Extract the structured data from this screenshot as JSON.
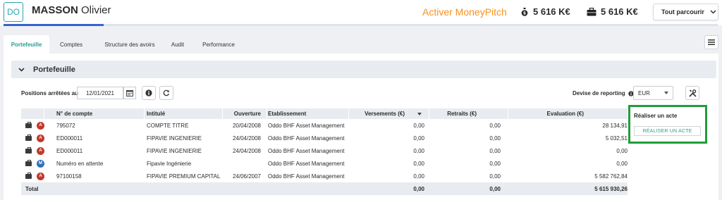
{
  "header": {
    "avatar_initials": "DO",
    "client_last_name": "MASSON",
    "client_first_name": "Olivier",
    "progress": 0.14,
    "activate_label": "Activer MoneyPitch",
    "amount_1": "5 616 K€",
    "amount_2": "5 616 K€",
    "browse_label": "Tout parcourir"
  },
  "tabs": [
    {
      "label": "Portefeuille",
      "active": true
    },
    {
      "label": "Comptes"
    },
    {
      "label": "Structure des avoirs"
    },
    {
      "label": "Audit"
    },
    {
      "label": "Performance"
    }
  ],
  "section": {
    "title": "Portefeuille"
  },
  "filters": {
    "positions_label": "Positions arrêtées au",
    "date_value": "12/01/2021",
    "currency_label": "Devise de reporting",
    "currency_value": "EUR"
  },
  "table": {
    "columns": [
      "N° de compte",
      "Intitulé",
      "Ouverture",
      "Etablissement",
      "Versements (€)",
      "Retraits (€)",
      "Evaluation (€)"
    ],
    "rows": [
      {
        "badge": "A",
        "badge_color": "#c0392b",
        "account": "795072",
        "title": "COMPTE TITRE",
        "opening": "20/04/2008",
        "institution": "Oddo BHF Asset Management",
        "deposits": "0,00",
        "withdrawals": "0,00",
        "valuation": "28 134,91"
      },
      {
        "badge": "A",
        "badge_color": "#c0392b",
        "account": "ED000011",
        "title": "FIPAVIE INGENIERIE",
        "opening": "24/04/2008",
        "institution": "Oddo BHF Asset Management",
        "deposits": "0,00",
        "withdrawals": "0,00",
        "valuation": "5 032,51"
      },
      {
        "badge": "A",
        "badge_color": "#c0392b",
        "account": "ED000011",
        "title": "FIPAVIE INGENIERIE",
        "opening": "24/04/2008",
        "institution": "Oddo BHF Asset Management",
        "deposits": "0,00",
        "withdrawals": "0,00",
        "valuation": "0,00"
      },
      {
        "badge": "M",
        "badge_color": "#2f6fbf",
        "account": "Numéro en attente",
        "title": "Fipavie Ingénierie",
        "opening": "",
        "institution": "Oddo BHF Asset Management",
        "deposits": "0,00",
        "withdrawals": "0,00",
        "valuation": "0,00"
      },
      {
        "badge": "A",
        "badge_color": "#c0392b",
        "account": "97100158",
        "title": "FIPAVIE PREMIUM CAPITALI...",
        "opening": "24/06/2007",
        "institution": "Oddo BHF Asset Management",
        "deposits": "0,00",
        "withdrawals": "0,00",
        "valuation": "5 582 762,84"
      }
    ],
    "total": {
      "label": "Total",
      "deposits": "0,00",
      "withdrawals": "0,00",
      "valuation": "5 615 930,26"
    }
  },
  "act_panel": {
    "title": "Réaliser un acte",
    "button_label": "RÉALISER UN ACTE"
  },
  "colors": {
    "accent": "#2a9d8f",
    "orange": "#f39323",
    "highlight": "#1f9e3a"
  }
}
